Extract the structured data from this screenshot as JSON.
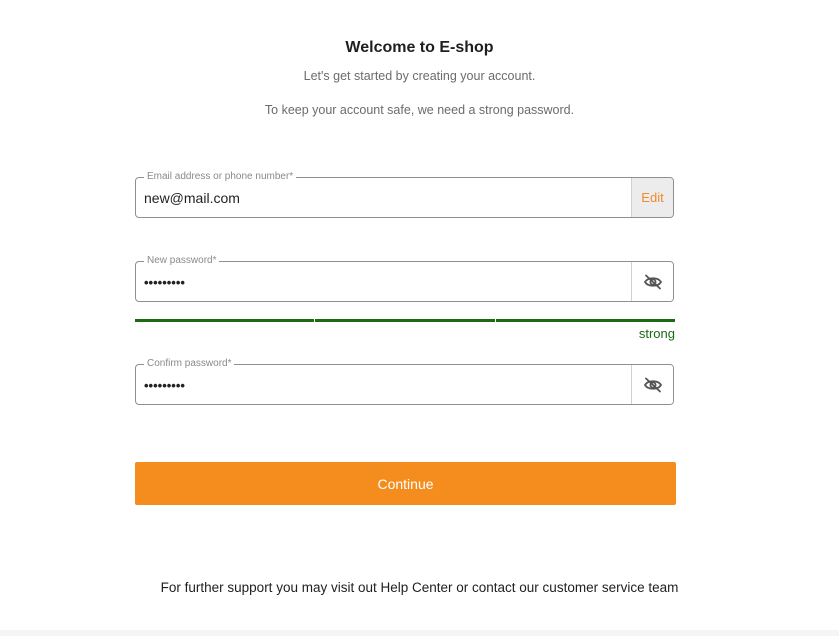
{
  "header": {
    "title": "Welcome to E-shop",
    "subtitle": "Let's get started by creating your account.",
    "info": "To keep your account safe, we need a strong password."
  },
  "email_field": {
    "label": "Email address or phone number*",
    "value": "new@mail.com",
    "edit_label": "Edit"
  },
  "new_password": {
    "label": "New password*",
    "value": "•••••••••",
    "toggle_icon": "eye-slash-icon"
  },
  "strength": {
    "label": "strong",
    "segments_filled": 3,
    "segments_total": 3,
    "color": "#1a6b12"
  },
  "confirm_password": {
    "label": "Confirm password*",
    "value": "•••••••••",
    "toggle_icon": "eye-slash-icon"
  },
  "continue_button": {
    "label": "Continue",
    "color": "#f58d1e"
  },
  "footer": {
    "text": "For further support you may visit out Help Center or contact our customer service team"
  }
}
